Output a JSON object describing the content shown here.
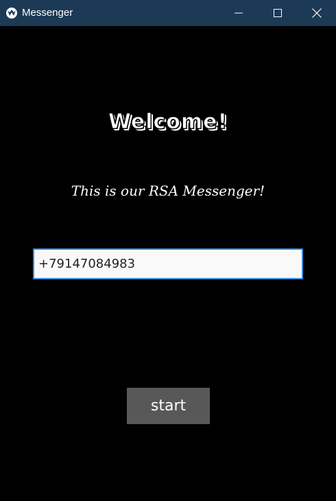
{
  "window": {
    "title": "Messenger",
    "app_icon": "kivy-logo-icon",
    "minimize_icon": "minimize-icon",
    "maximize_icon": "maximize-icon",
    "close_icon": "close-icon",
    "titlebar_color": "#1c3a56"
  },
  "main": {
    "heading": "Welcome!",
    "subtitle": "This is our RSA Messenger!",
    "phone_input": {
      "value": "+79147084983",
      "border_color": "#3c8fe0"
    },
    "start_label": "start",
    "button_color": "#585858",
    "background_color": "#000000"
  }
}
